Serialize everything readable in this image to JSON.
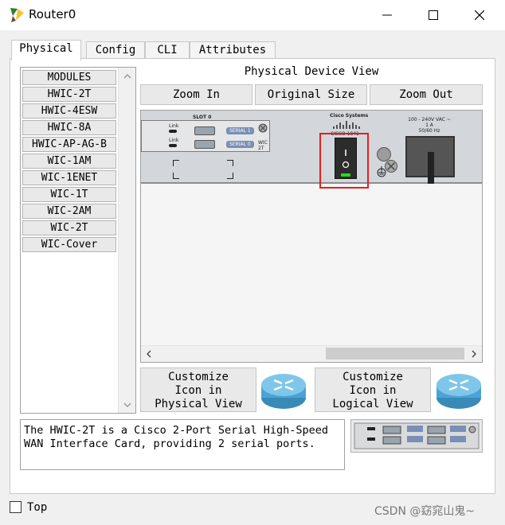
{
  "window": {
    "title": "Router0",
    "minimize_icon": "minimize-icon",
    "maximize_icon": "maximize-icon",
    "close_icon": "close-icon"
  },
  "tabs": [
    {
      "label": "Physical",
      "active": true
    },
    {
      "label": "Config"
    },
    {
      "label": "CLI"
    },
    {
      "label": "Attributes"
    }
  ],
  "modules": {
    "items": [
      "MODULES",
      "HWIC-2T",
      "HWIC-4ESW",
      "HWIC-8A",
      "HWIC-AP-AG-B",
      "WIC-1AM",
      "WIC-1ENET",
      "WIC-1T",
      "WIC-2AM",
      "WIC-2T",
      "WIC-Cover"
    ]
  },
  "physical_view": {
    "title": "Physical Device View",
    "zoom_in": "Zoom In",
    "original_size": "Original Size",
    "zoom_out": "Zoom Out",
    "device": {
      "slot_label": "SLOT 0",
      "link_label_1": "Link",
      "link_label_2": "Link",
      "serial1": "SERIAL 1",
      "serial0": "SERIAL 0",
      "card_model_1": "WIC",
      "card_model_2": "2T",
      "brand": "Cisco Systems",
      "model": "CISCO 1841",
      "power_line_1": "100 - 240V VAC ~",
      "power_line_2": "1 A",
      "power_line_3": "50/60 Hz",
      "power_led_color": "#22dd22",
      "highlight_color": "#e02020"
    }
  },
  "customize": {
    "physical_label": "Customize\nIcon in\nPhysical View",
    "logical_label": "Customize\nIcon in\nLogical View"
  },
  "description": "The HWIC-2T is a Cisco 2-Port Serial High-Speed\nWAN Interface Card, providing 2 serial ports.",
  "footer": {
    "top_label": "Top",
    "watermark": "CSDN @窈窕山鬼~"
  }
}
